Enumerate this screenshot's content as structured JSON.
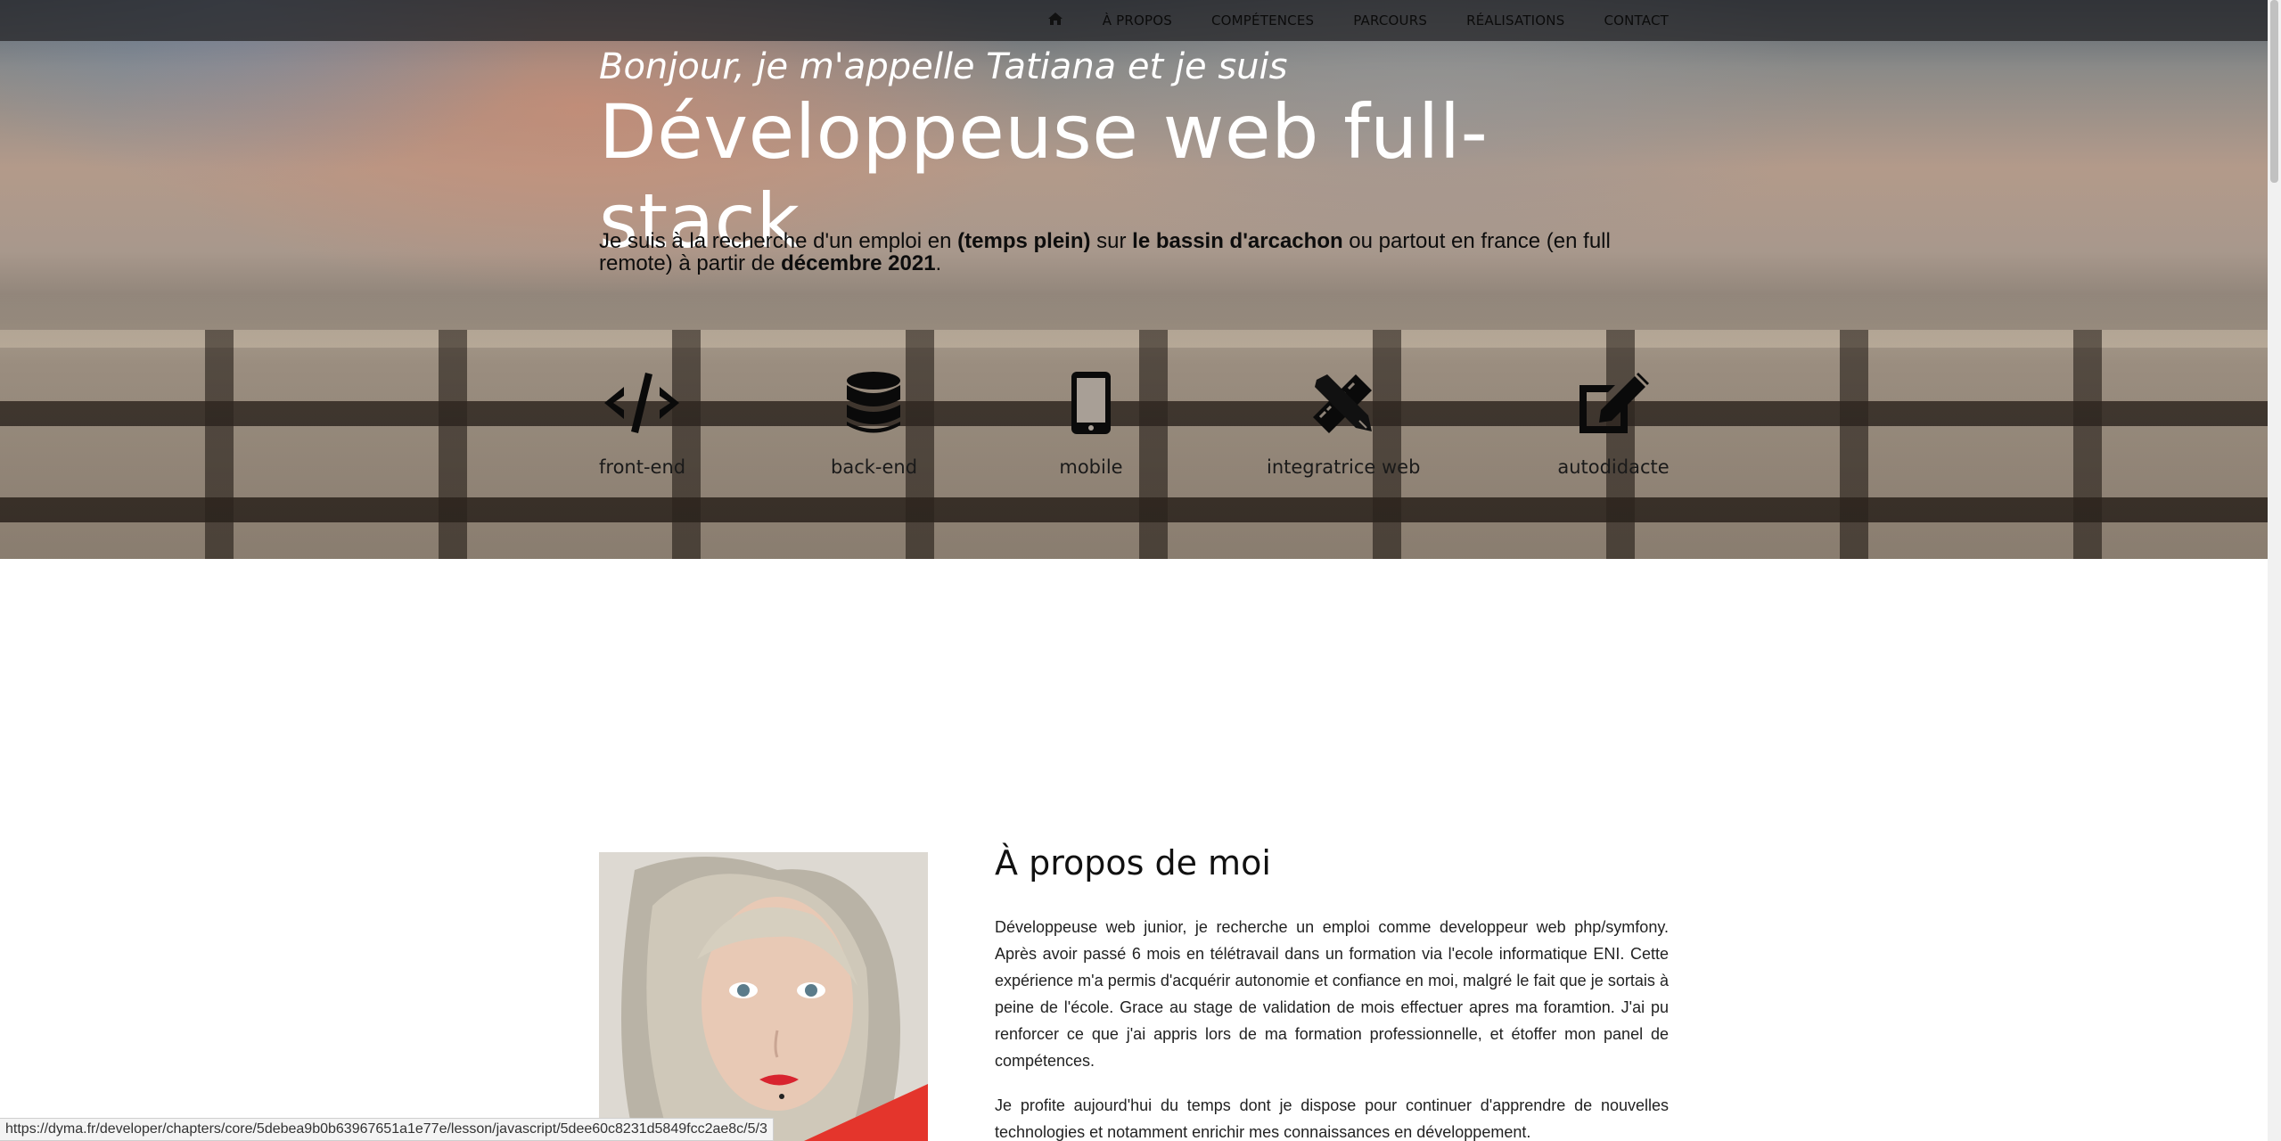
{
  "nav": {
    "home_icon": "home-icon",
    "items": [
      {
        "label": "À PROPOS"
      },
      {
        "label": "COMPÉTENCES"
      },
      {
        "label": "PARCOURS"
      },
      {
        "label": "RÉALISATIONS"
      },
      {
        "label": "CONTACT"
      }
    ]
  },
  "hero": {
    "subtitle": "Bonjour, je m'appelle Tatiana et je suis",
    "title": "Développeuse web full-stack",
    "desc": {
      "p1": "Je suis à la recherche d'un emploi en ",
      "b1": "(temps plein)",
      "p2": " sur ",
      "b2": "le bassin d'arcachon",
      "p3": " ou partout en france (en full remote) à partir de ",
      "b3": "décembre 2021",
      "p4": "."
    }
  },
  "skills": [
    {
      "icon": "code-icon",
      "label": "front-end"
    },
    {
      "icon": "database-icon",
      "label": "back-end"
    },
    {
      "icon": "mobile-icon",
      "label": "mobile"
    },
    {
      "icon": "pencil-ruler-icon",
      "label": "integratrice web"
    },
    {
      "icon": "edit-icon",
      "label": "autodidacte"
    }
  ],
  "about": {
    "title": "À propos de moi",
    "paragraph1": "Développeuse web junior, je recherche un emploi comme developpeur web php/symfony. Après avoir passé 6 mois en télétravail dans un formation via l'ecole informatique ENI. Cette expérience m'a permis d'acquérir autonomie et confiance en moi, malgré le fait que je sortais à peine de l'école. Grace au stage de validation de mois effectuer apres ma foramtion. J'ai pu renforcer ce que j'ai appris lors de ma formation professionnelle, et étoffer mon panel de compétences.",
    "paragraph2": "Je profite aujourd'hui du temps dont je dispose pour continuer d'apprendre de nouvelles technologies et notamment enrichir mes connaissances en développement."
  },
  "status_bar": {
    "url": "https://dyma.fr/developer/chapters/core/5debea9b0b63967651a1e77e/lesson/javascript/5dee60c8231d5849fcc2ae8c/5/3"
  },
  "colors": {
    "nav_bg": "#28282a",
    "text_dark": "#0d0d0d",
    "hero_text": "#ffffff"
  }
}
